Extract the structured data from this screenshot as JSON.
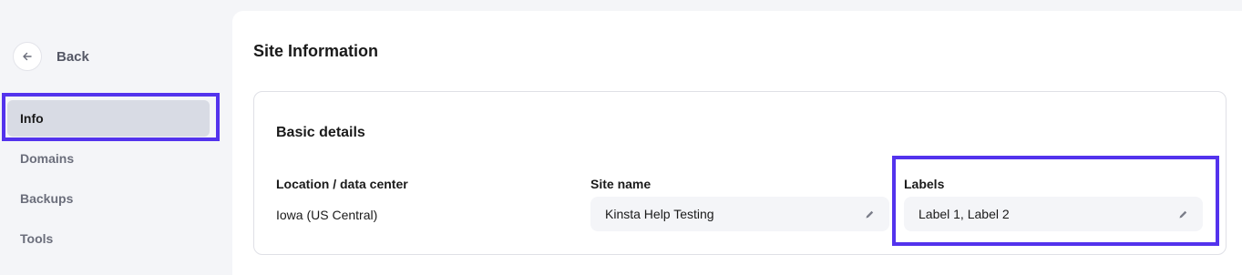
{
  "sidebar": {
    "back_label": "Back",
    "items": [
      {
        "label": "Info",
        "active": true
      },
      {
        "label": "Domains",
        "active": false
      },
      {
        "label": "Backups",
        "active": false
      },
      {
        "label": "Tools",
        "active": false
      }
    ]
  },
  "main": {
    "title": "Site Information",
    "card": {
      "title": "Basic details",
      "location": {
        "label": "Location / data center",
        "value": "Iowa (US Central)"
      },
      "site_name": {
        "label": "Site name",
        "value": "Kinsta Help Testing"
      },
      "labels": {
        "label": "Labels",
        "value": "Label 1, Label 2"
      }
    }
  },
  "colors": {
    "highlight": "#5333ed",
    "active_nav_bg": "#d8dbe4",
    "page_bg": "#f4f5f8"
  },
  "icons": {
    "back": "arrow-left-icon",
    "edit": "pencil-icon"
  }
}
